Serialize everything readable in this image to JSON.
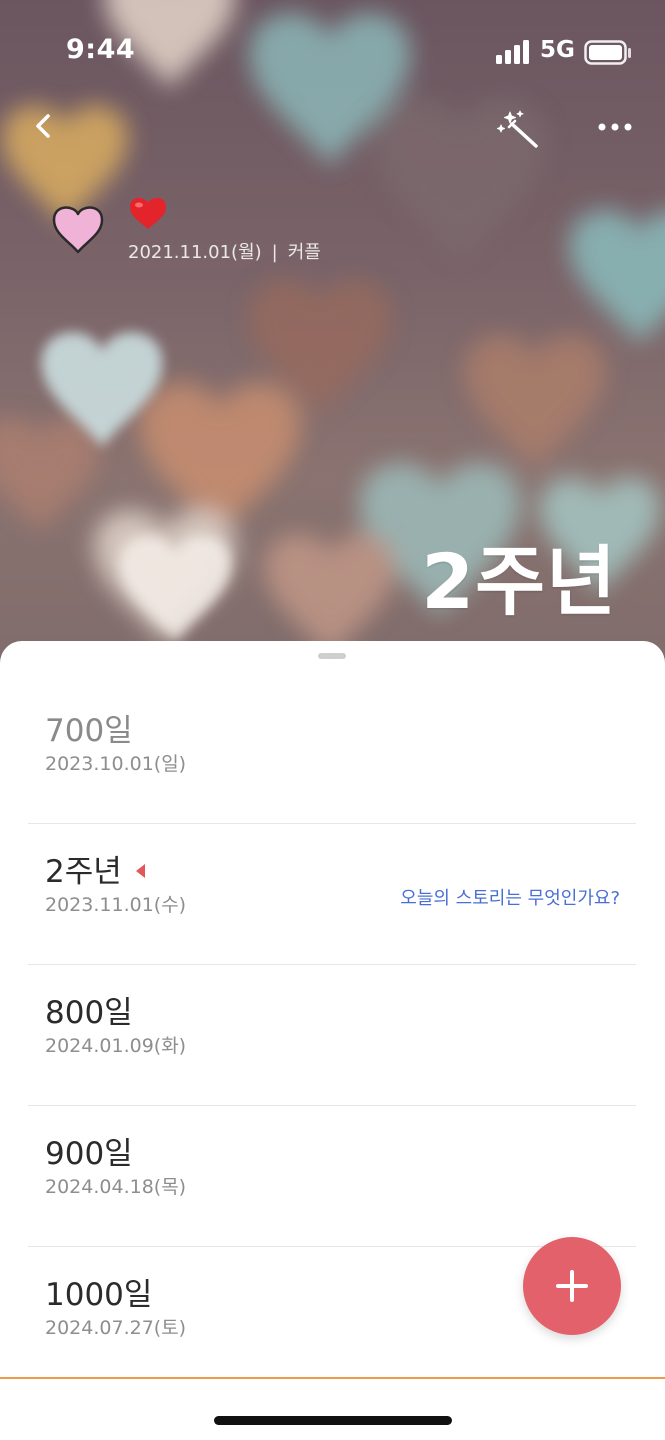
{
  "status_bar": {
    "time": "9:44",
    "network": "5G"
  },
  "header": {
    "back_icon": "chevron-left-icon",
    "magic_icon": "magic-wand-icon",
    "more_icon": "more-horizontal-icon"
  },
  "profile": {
    "avatar_icon": "pink-heart-icon",
    "emoji": "❤️",
    "start_date": "2021.11.01(월)",
    "separator": "|",
    "category": "커플"
  },
  "hero": {
    "title": "2주년"
  },
  "anniversaries": [
    {
      "title": "700일",
      "date": "2023.10.01(일)",
      "state": "past"
    },
    {
      "title": "2주년",
      "date": "2023.11.01(수)",
      "state": "today",
      "story_prompt": "오늘의 스토리는 무엇인가요?"
    },
    {
      "title": "800일",
      "date": "2024.01.09(화)",
      "state": "upcoming"
    },
    {
      "title": "900일",
      "date": "2024.04.18(목)",
      "state": "upcoming"
    },
    {
      "title": "1000일",
      "date": "2024.07.27(토)",
      "state": "upcoming"
    }
  ],
  "fab": {
    "icon": "plus-icon"
  },
  "colors": {
    "accent": "#e3616a",
    "link": "#4a6fd4",
    "divider": "#ef9a4a"
  }
}
